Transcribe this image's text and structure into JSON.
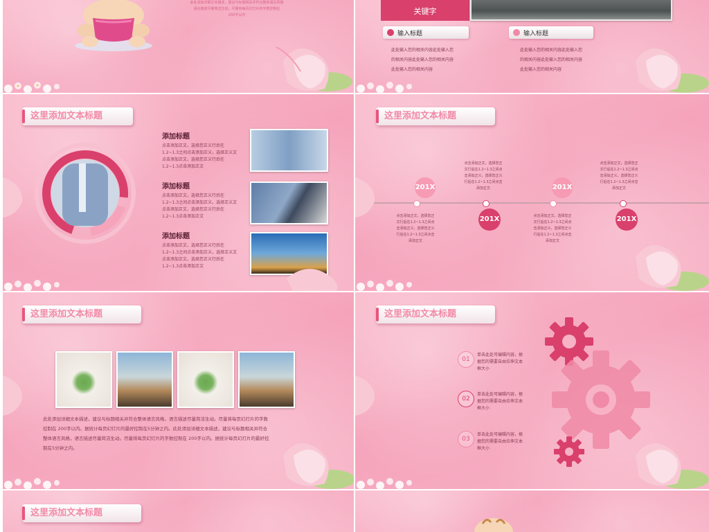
{
  "slide_top_left": {
    "tiny_text_1": "此处添加详细文本描述，建议与标题相关并符合整体语言风格",
    "tiny_text_2": "语言描述尽量简洁生动，尽量将每页幻灯片的字数控制在",
    "tiny_text_3": "200字以内"
  },
  "slide_top_right": {
    "keyword": "关键字",
    "col1_title": "输入标题",
    "col1_text": [
      "此处输入您的相关内容此处输入您",
      "的相关内容此处输入您的相关内容",
      "此处输入您的相关内容"
    ],
    "col2_title": "输入标题",
    "col2_text": [
      "此处输入您的相关内容此处输入您",
      "的相关内容此处输入您的相关内容",
      "此处输入您的相关内容"
    ]
  },
  "slide_mid_left": {
    "title": "这里添加文本标题",
    "items": [
      {
        "heading": "添加标题",
        "lines": [
          "点击添加正文，选择您正义行后在",
          "1.2~1.3之间点击添加正义，选择正义文",
          "点击添加正文，选择您正义行后在",
          "1.2~1.3点击添加正文"
        ]
      },
      {
        "heading": "添加标题",
        "lines": [
          "点击添加正文，选择您正义行后在",
          "1.2~1.3之间点击添加正义，选择正义文",
          "点击添加正文，选择您正义行后在",
          "1.2~1.3点击添加正文"
        ]
      },
      {
        "heading": "添加标题",
        "lines": [
          "点击添加正文，选择您正义行后在",
          "1.2~1.3之间点击添加正义，选择正义文",
          "点击添加正文，选择您正义行后在",
          "1.2~1.3点击添加正文"
        ]
      }
    ]
  },
  "slide_mid_right": {
    "title": "这里添加文本标题",
    "years": [
      "201X",
      "201X",
      "201X",
      "201X"
    ],
    "texts_above": [
      [
        "点击添加正文，选择您正",
        "文行后在1.2~1.3之间点",
        "击添加正义，选择您正义",
        "行后在1.2~1.3之间点击",
        "添加正文"
      ],
      [
        "点击添加正文，选择您正",
        "文行后在1.2~1.3之间点",
        "击添加正义，选择您正义",
        "行后在1.2~1.3之间点击",
        "添加正文"
      ]
    ],
    "texts_below": [
      [
        "点击添加正文，选择您正",
        "文行后在1.2~1.3之间点",
        "击添加正义，选择您正义",
        "行后在1.2~1.3之间点击",
        "添加正文"
      ],
      [
        "点击添加正文，选择您正",
        "文行后在1.2~1.3之间点",
        "击添加正义，选择您正义",
        "行后在1.2~1.3之间点击",
        "添加正文"
      ]
    ]
  },
  "slide_low_left": {
    "title": "这里添加文本标题",
    "body": [
      "此处添加详细文本描述，建议与标题相关并符合整体语言风格，语言描述尽量简洁生动。尽量将每页幻灯片的字数",
      "控制在  200字以内。据统计每页幻灯片的最好控制在5分钟之内。此处添加详细文本描述，建议与标题相关并符合",
      "整体语言风格，语言描述尽量简洁生动。尽量将每页幻灯片的字数控制在  200字以内。据统计每页幻灯片的最好控",
      "制在5分钟之内。"
    ]
  },
  "slide_low_right": {
    "title": "这里添加文本标题",
    "items": [
      {
        "num": "01",
        "lines": [
          "单击此处可编辑内容，根",
          "据您的需要自由拉伸文本",
          "框大小"
        ]
      },
      {
        "num": "02",
        "lines": [
          "单击此处可编辑内容，根",
          "据您的需要自由拉伸文本",
          "框大小"
        ]
      },
      {
        "num": "03",
        "lines": [
          "单击此处可编辑内容，根",
          "据您的需要自由拉伸文本",
          "框大小"
        ]
      }
    ]
  },
  "slide_bottom_left": {
    "title": "这里添加文本标题"
  },
  "colors": {
    "accent": "#e8557c",
    "accent_dark": "#d9406c",
    "pink_bg": "#f7b2c6",
    "title_text": "#f28aa7"
  }
}
